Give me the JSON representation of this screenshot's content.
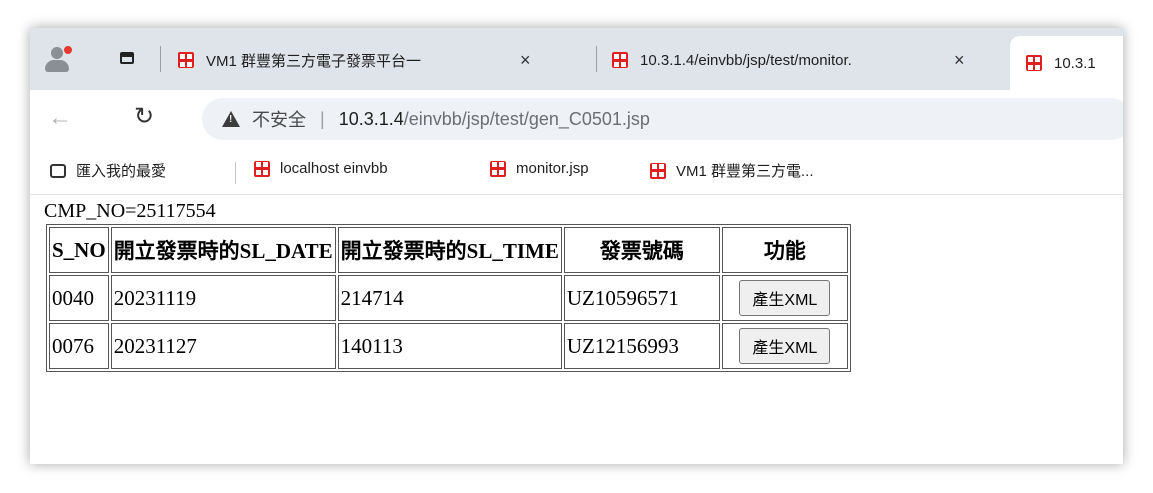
{
  "tabs": [
    {
      "title": "VM1 群豐第三方電子發票平台一",
      "close": "×"
    },
    {
      "title": "10.3.1.4/einvbb/jsp/test/monitor.",
      "close": "×"
    },
    {
      "title": "10.3.1"
    }
  ],
  "address_bar": {
    "security_label": "不安全",
    "divider": "|",
    "url_host": "10.3.1.4",
    "url_path": "/einvbb/jsp/test/gen_C0501.jsp"
  },
  "bookmarks": [
    {
      "label": "匯入我的最愛",
      "icon": "import-icon"
    },
    {
      "label": "localhost einvbb",
      "icon": "uniqlo-favicon"
    },
    {
      "label": "monitor.jsp",
      "icon": "uniqlo-favicon"
    },
    {
      "label": "VM1 群豐第三方電...",
      "icon": "uniqlo-favicon"
    }
  ],
  "page": {
    "cmp_no": "CMP_NO=25117554",
    "table": {
      "headers": [
        "S_NO",
        "開立發票時的SL_DATE",
        "開立發票時的SL_TIME",
        "發票號碼",
        "功能"
      ],
      "rows": [
        {
          "s_no": "0040",
          "sl_date": "20231119",
          "sl_time": "214714",
          "invoice": "UZ10596571",
          "action": "產生XML"
        },
        {
          "s_no": "0076",
          "sl_date": "20231127",
          "sl_time": "140113",
          "invoice": "UZ12156993",
          "action": "產生XML"
        }
      ]
    }
  },
  "colors": {
    "tabstrip_bg": "#dfe3ea",
    "favicon_red": "#e02020",
    "profile_dot": "#e5382c"
  }
}
